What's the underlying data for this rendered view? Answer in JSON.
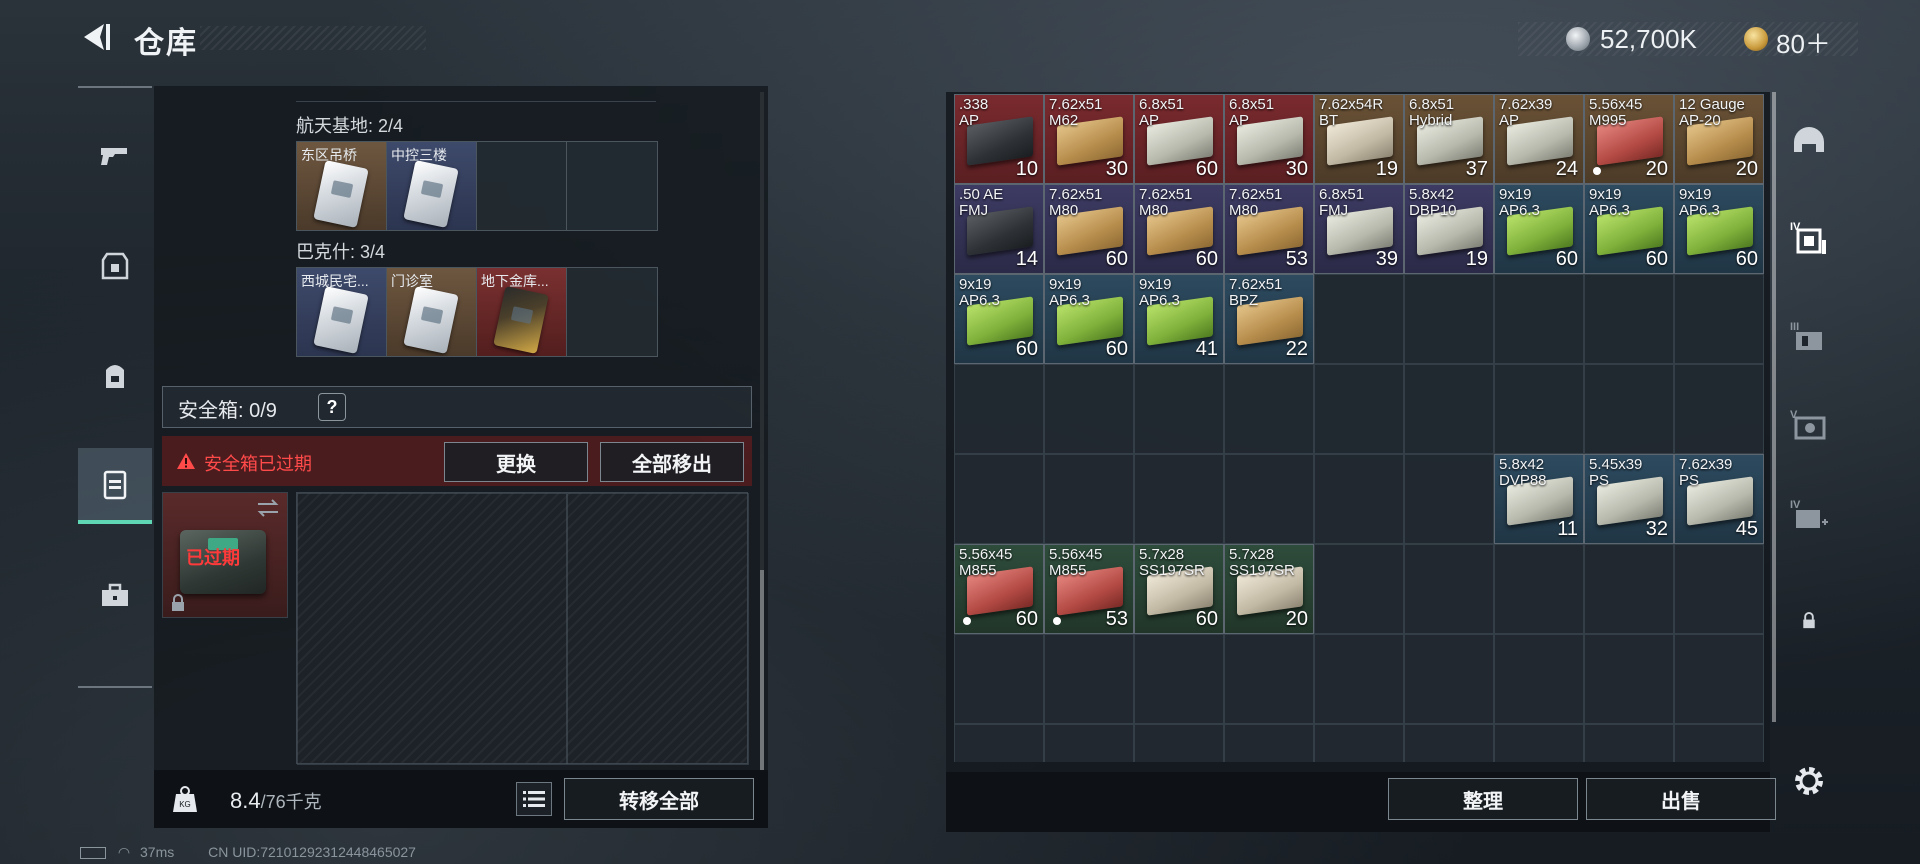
{
  "header": {
    "title": "仓库"
  },
  "currency": {
    "coins": "52,700K",
    "gold": "80＋"
  },
  "key_groups": [
    {
      "label": "航天基地: 2/4",
      "keys": [
        {
          "name": "东区吊桥",
          "color": "orange",
          "card": "white"
        },
        {
          "name": "中控三楼",
          "color": "blue",
          "card": "white"
        },
        {
          "name": "",
          "color": "",
          "card": ""
        },
        {
          "name": "",
          "color": "",
          "card": ""
        }
      ]
    },
    {
      "label": "巴克什: 3/4",
      "keys": [
        {
          "name": "西城民宅...",
          "color": "blue",
          "card": "white"
        },
        {
          "name": "门诊室",
          "color": "orange",
          "card": "white"
        },
        {
          "name": "地下金库...",
          "color": "red",
          "card": "gold"
        },
        {
          "name": "",
          "color": "",
          "card": ""
        }
      ]
    }
  ],
  "safebox": {
    "title": "安全箱: 0/9",
    "help": "?",
    "expired_text": "安全箱已过期",
    "replace_label": "更换",
    "move_all_label": "全部移出",
    "overlay_text": "已过期"
  },
  "capacity": {
    "current": "8.4",
    "max": "/76千克",
    "transfer_label": "转移全部"
  },
  "status": {
    "ping": "37ms",
    "uid": "CN UID:72101292312448465027"
  },
  "inventory": [
    {
      "name": ".338\nAP",
      "count": "10",
      "color": "c-red",
      "pic": "pic-black",
      "dot": false
    },
    {
      "name": "7.62x51\nM62",
      "count": "30",
      "color": "c-red",
      "pic": "pic-tan",
      "dot": false
    },
    {
      "name": "6.8x51\nAP",
      "count": "60",
      "color": "c-red",
      "pic": "pic-grey",
      "dot": false
    },
    {
      "name": "6.8x51\nAP",
      "count": "30",
      "color": "c-red",
      "pic": "pic-grey",
      "dot": false
    },
    {
      "name": "7.62x54R\nBT",
      "count": "19",
      "color": "c-brown",
      "pic": "pic-box",
      "dot": false
    },
    {
      "name": "6.8x51\nHybrid",
      "count": "37",
      "color": "c-brown",
      "pic": "pic-grey",
      "dot": false
    },
    {
      "name": "7.62x39\nAP",
      "count": "24",
      "color": "c-brown",
      "pic": "pic-grey",
      "dot": false
    },
    {
      "name": "5.56x45\nM995",
      "count": "20",
      "color": "c-brown",
      "pic": "pic-red",
      "dot": true
    },
    {
      "name": "12 Gauge\nAP-20",
      "count": "20",
      "color": "c-brown",
      "pic": "pic-tan",
      "dot": false
    },
    {
      "name": ".50 AE\nFMJ",
      "count": "14",
      "color": "c-purple",
      "pic": "pic-black",
      "dot": false
    },
    {
      "name": "7.62x51\nM80",
      "count": "60",
      "color": "c-purple",
      "pic": "pic-tan",
      "dot": false
    },
    {
      "name": "7.62x51\nM80",
      "count": "60",
      "color": "c-purple",
      "pic": "pic-tan",
      "dot": false
    },
    {
      "name": "7.62x51\nM80",
      "count": "53",
      "color": "c-purple",
      "pic": "pic-tan",
      "dot": false
    },
    {
      "name": "6.8x51\nFMJ",
      "count": "39",
      "color": "c-purple",
      "pic": "pic-grey",
      "dot": false
    },
    {
      "name": "5.8x42\nDBP10",
      "count": "19",
      "color": "c-purple",
      "pic": "pic-grey",
      "dot": false
    },
    {
      "name": "9x19\nAP6.3",
      "count": "60",
      "color": "c-blue",
      "pic": "pic-lime",
      "dot": false
    },
    {
      "name": "9x19\nAP6.3",
      "count": "60",
      "color": "c-blue",
      "pic": "pic-lime",
      "dot": false
    },
    {
      "name": "9x19\nAP6.3",
      "count": "60",
      "color": "c-blue",
      "pic": "pic-lime",
      "dot": false
    },
    {
      "name": "9x19\nAP6.3",
      "count": "60",
      "color": "c-blue",
      "pic": "pic-lime",
      "dot": false
    },
    {
      "name": "9x19\nAP6.3",
      "count": "60",
      "color": "c-blue",
      "pic": "pic-lime",
      "dot": false
    },
    {
      "name": "9x19\nAP6.3",
      "count": "41",
      "color": "c-blue",
      "pic": "pic-lime",
      "dot": false
    },
    {
      "name": "7.62x51\nBPZ",
      "count": "22",
      "color": "c-blue",
      "pic": "pic-tan",
      "dot": false
    },
    {
      "name": "5.8x42\nDVP88",
      "count": "11",
      "color": "c-blue",
      "pic": "pic-grey",
      "dot": false
    },
    {
      "name": "5.45x39\nPS",
      "count": "32",
      "color": "c-blue",
      "pic": "pic-grey",
      "dot": false
    },
    {
      "name": "7.62x39\nPS",
      "count": "45",
      "color": "c-blue",
      "pic": "pic-grey",
      "dot": false
    },
    {
      "name": "5.56x45\nM855",
      "count": "60",
      "color": "c-green",
      "pic": "pic-red",
      "dot": true
    },
    {
      "name": "5.56x45\nM855",
      "count": "53",
      "color": "c-green",
      "pic": "pic-red",
      "dot": true
    },
    {
      "name": "5.7x28\nSS197SR",
      "count": "60",
      "color": "c-green",
      "pic": "pic-box",
      "dot": false
    },
    {
      "name": "5.7x28\nSS197SR",
      "count": "20",
      "color": "c-green",
      "pic": "pic-box",
      "dot": false
    }
  ],
  "actions": {
    "sort_label": "整理",
    "sell_label": "出售"
  },
  "right_nav_icons": [
    "helmet-icon",
    "iv-armor-icon",
    "iii-rig-icon",
    "v-weapon-icon",
    "iv-medkit-icon",
    "lock-icon"
  ],
  "left_nav_icons": [
    "pistol-icon",
    "armor-icon",
    "backpack-icon",
    "safebox-icon",
    "toolbox-icon"
  ],
  "colors": {
    "accent": "#5fd6b4",
    "warning": "#ff4a4a"
  }
}
